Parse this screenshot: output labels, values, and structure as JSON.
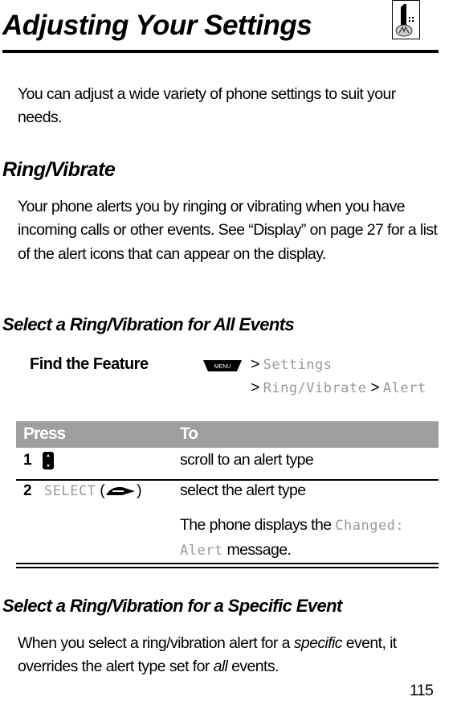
{
  "header": {
    "title": "Adjusting Your Settings",
    "corner_icon": "motorola-phone-icon"
  },
  "intro": "You can adjust a wide variety of phone settings to suit your needs.",
  "ring_vibrate": {
    "heading": "Ring/Vibrate",
    "body": "Your phone alerts you by ringing or vibrating when you have incoming calls or other events. See “Display” on page 27 for a list of the alert icons that can appear on the display."
  },
  "all_events": {
    "heading": "Select a Ring/Vibration for All Events",
    "find_feature": {
      "label": "Find the Feature",
      "menu_key": "MENU",
      "sep": ">",
      "path": [
        "Settings",
        "Ring/Vibrate",
        "Alert"
      ]
    },
    "table": {
      "headers": [
        "Press",
        "To"
      ],
      "rows": [
        {
          "num": "1",
          "press_icon": "scroll-key-icon",
          "to": "scroll to an alert type"
        },
        {
          "num": "2",
          "press": "SELECT",
          "press_open": "(",
          "press_close": ")",
          "press_icon": "right-soft-key-icon",
          "to": "select the alert type",
          "note_pre": "The phone displays the",
          "note_display": "Changed: Alert",
          "note_post": "message."
        }
      ]
    }
  },
  "specific_event": {
    "heading": "Select a Ring/Vibration for a Specific Event",
    "body_pre": "When you select a ring/vibration alert for a ",
    "body_em1": "specific",
    "body_mid": " event, it overrides the alert type set for ",
    "body_em2": "all",
    "body_post": " events."
  },
  "footer": {
    "page_number": "115"
  }
}
